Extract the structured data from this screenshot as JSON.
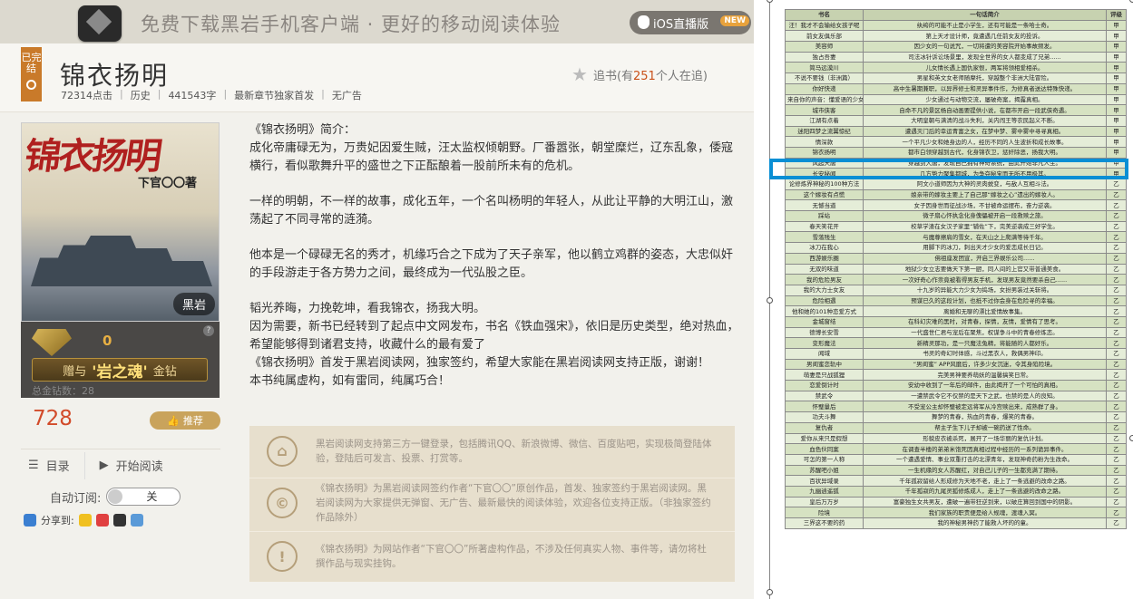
{
  "banner": {
    "text": "免费下载黑岩手机客户端 · 更好的移动阅读体验",
    "ios_label": "iOS直播版",
    "new_badge": "NEW"
  },
  "book": {
    "status": "已完结",
    "title": "锦衣扬明",
    "meta": [
      "72314点击",
      "|",
      "历史",
      "|",
      "441543字",
      "|",
      "最新章节独家首发",
      "|",
      "无广告"
    ],
    "follow_prefix": "追书(有",
    "follow_count": "251",
    "follow_suffix": "个人在追)",
    "cover_title": "锦衣扬明",
    "cover_author": "下官〇〇著",
    "cover_brand": "黑岩",
    "gift_count": "0",
    "gift_btn_pre": "赠与",
    "gift_btn_big": "'岩之魂'",
    "gift_btn_post": "金钻",
    "gift_total": "总金钻数：28",
    "votes": "728",
    "recommend": "推荐",
    "nav_catalog": "目录",
    "nav_read": "开始阅读",
    "auto_label": "自动订阅:",
    "auto_value": "关",
    "share_label": "分享到:"
  },
  "intro": {
    "p1": "《锦衣扬明》简介：",
    "p2": "成化帝庸碌无为，万贵妃因爱生贼，汪太监权倾朝野。厂番嚣张，朝堂糜烂，辽东乱象，倭寇横行，看似歌舞升平的盛世之下正酝酿着一股前所未有的危机。",
    "p3": "一样的明朝，不一样的故事，成化五年，一个名叫杨明的年轻人，从此让平静的大明江山，激荡起了不同寻常的涟漪。",
    "p4": "他本是一个碌碌无名的秀才，机缘巧合之下成为了天子亲军，他以鹤立鸡群的姿态，大忠似奸的手段游走于各方势力之间，最终成为一代弘股之臣。",
    "p5": "韬光养晦，力挽乾坤，看我锦衣，扬我大明。",
    "p6": "因为需要，新书已经转到了起点中文网发布，书名《铁血强宋》，依旧是历史类型，绝对热血，希望能够得到诸君支持，收藏什么的最有爱了",
    "p7": "《锦衣扬明》首发于黑岩阅读网，独家签约，希望大家能在黑岩阅读网支持正版，谢谢！",
    "p8": "本书纯属虚构，如有雷同，纯属巧合！"
  },
  "notes": [
    {
      "icon": "lock",
      "text": "黑岩阅读网支持第三方一键登录，包括腾讯QQ、新浪微博、微信、百度贴吧，实现极简登陆体验，登陆后可发言、投票、打赏等。"
    },
    {
      "icon": "copyright",
      "text": "《锦衣扬明》为黑岩阅读网签约作者“下官〇〇”原创作品，首发、独家签约于黑岩阅读网。黑岩阅读网为大家提供无弹窗、无广告、最新最快的阅读体验，欢迎各位支持正版。（非独家签约作品除外）"
    },
    {
      "icon": "warning",
      "text": "《锦衣扬明》为网站作者“下官〇〇”所著虚构作品，不涉及任何真实人物、事件等，请勿将杜撰作品与现实挂钩。"
    }
  ],
  "table": {
    "headers": [
      "书名",
      "一句话简介",
      "评级"
    ],
    "rows": [
      [
        "汪！我才不会输给女孩子呢",
        "纨绔的可能不止是小学生，还有可能是一条哈士奇。",
        "甲"
      ],
      [
        "前女友俱乐部",
        "第上天才设计师，竟遭遇几任前女友的投诉。",
        "甲"
      ],
      [
        "美容师",
        "因少女的一句说咒，一切将遭的美容院开始事故频发。",
        "甲"
      ],
      [
        "独占吾妻",
        "司法冰针诉讼场景里，发现全世界的女人都变成了兄弟......",
        "甲"
      ],
      [
        "简马远漠川",
        "儿女情长遇上国仇家恨，两军将领相爱相杀。",
        "甲"
      ],
      [
        "不说不要钱（非洲篇）",
        "男星和英文女老师随摩托，穿越整个非洲大陆冒险。",
        "甲"
      ],
      [
        "你好快递",
        "高中生暑期兼职，以异界修士和灵异事件作，为修真者送达特殊快递。",
        "甲"
      ],
      [
        "来自你的声音：懂爱语的少女",
        "少女通过与动物交流，屡破奇案，揭露真相。",
        "甲"
      ],
      [
        "城市侠客",
        "自命不凡的景区杨自动画要提供小说，在都市开启一段武侠奇遇。",
        "甲"
      ],
      [
        "江湖有点着",
        "大明皇朝与满清的战斗失利，关内闯王等农民起义不断。",
        "甲"
      ],
      [
        "迷阳四梦之流翼惊纪",
        "遭遇灭门后的幸运青富之女，在梦中梦、雾中雾中寻寻真相。",
        "甲"
      ],
      [
        "情深款",
        "一个平凡少女和她身边的人，经历不同的人生波折和成长故事。",
        "甲"
      ],
      [
        "锦衣扬明",
        "都市白领穿越到古代，化身锦衣卫，惩奸除恶，扬我大明。",
        "甲"
      ],
      [
        "风起天唐",
        "穿越到大唐，发现自己拥有神奇系统，由此开始非凡人生。",
        "甲"
      ],
      [
        "长安秘闻",
        "几方势力聚集都城，为争夺秘宝而无所不用极其。",
        "甲"
      ],
      [
        "论修炼界神秘的100种方法",
        "阿文小道师因为大神的灵肉蜕变，与敌人互相斗法。",
        "乙"
      ],
      [
        "这个嫁妆有点慌",
        "娘亲带的嫁妆主要上了自己那“嫁妆之心”遗出的嫁妆人。",
        "乙"
      ],
      [
        "无憾当道",
        "女子因身世而征战沙场，不甘被命运摆布，奋力逆袭。",
        "乙"
      ],
      [
        "踩站",
        "微子扇心怀执念化身傀儡被开启一段救赎之旅。",
        "乙"
      ],
      [
        "春天笑花开",
        "校草学渣在女汉子家里“辅佐”下，完美逆袭成三好学生。",
        "乙"
      ],
      [
        "雪落残生",
        "与魔尊擦肩的雪女，在天山之上爬满等待千年。",
        "乙"
      ],
      [
        "冰刀在我心",
        "用脚下的冰刀，刺出天才少女的爱恋成长日记。",
        "乙"
      ],
      [
        "西游娱乐圈",
        "佛祖座发团宣，开启三界娱乐公司......",
        "乙"
      ],
      [
        "无双的味道",
        "地狱少女立志要做天下第一厨，同人间的上官又带普通美食。",
        "乙"
      ],
      [
        "我的危险男友",
        "一次好奇心作祟竟被看得男友手机，发现男友竟然要杀自己......",
        "乙"
      ],
      [
        "我的大力士女友",
        "十九岁的异能大力少女为捣场，女扮男装过关斩将。",
        "乙"
      ],
      [
        "危险相遇",
        "预谋已久的这段计划，也抵不过你会身在危险寻的幸福。",
        "乙"
      ],
      [
        "他和她的101种恋爱方式",
        "离婚和无聊的漂比爱情故事集。",
        "乙"
      ],
      [
        "金城窗结",
        "在科幻灾难的黑时，对青春，探情，友情，爱情有了思考。",
        "乙"
      ],
      [
        "德博长安雪",
        "一代盛世仁君与宠后在聚焦，权谋争斗中的青春修炼恋。",
        "乙"
      ],
      [
        "变形魔法",
        "新精灵那功，是一只魔法兔精，将能随的人都好乐。",
        "乙"
      ],
      [
        "闻域",
        "书灵的奇幻时体感，斗过黑衣人，救偶男神印。",
        "乙"
      ],
      [
        "男闺蜜恋轨中",
        "“男闺蜜” APP风靡后，许多少女沉迷，令其身陷险境。",
        "乙"
      ],
      [
        "萌妻是只战狐狸",
        "完美男神要养萌妖的温馨搞笑日常。",
        "乙"
      ],
      [
        "恋爱倒计时",
        "安幼中收到了一年后的邮件，由此揭开了一个可怕的真相。",
        "乙"
      ],
      [
        "禁武令",
        "一遭禁武令它不仅禁的是天下之武，也禁的是人的良知。",
        "乙"
      ],
      [
        "怀璧量后",
        "不受宠公主却怀璧被定远将军从冷宫赎出来，成熟群了身。",
        "乙"
      ],
      [
        "功夫斗舞",
        "舞梦的青春，热血的青春，爆笑的青春。",
        "乙"
      ],
      [
        "复仇者",
        "帮主子生下儿子却被一碗药送了性命。",
        "乙"
      ],
      [
        "爱你从来只是假想",
        "形貌皮衣被杀死，展开了一场华丽的复仇计划。",
        "乙"
      ],
      [
        "血色伙同案",
        "在调查半楼的弟弟米饱死因真相过程中经历的一系列诡异事件。",
        "乙"
      ],
      [
        "可怎的第一人称",
        "一个遭遇爱情、事业双重打击的北漂青年，发现神奇药粉为生改命。",
        "乙"
      ],
      [
        "苏醒吧小姐",
        "一生机缘的女人苏醒红，对自己儿子的一生都充满了期待。",
        "乙"
      ],
      [
        "百状异域录",
        "千年孤寂留给人形成修为天地不老，走上了一条逃避的改命之路。",
        "乙"
      ],
      [
        "九幽逍遥狐",
        "千年孤寂的九尾灵狐修炼成人，走上了一条逃避的改命之路。",
        "乙"
      ],
      [
        "皇后万万岁",
        "富豪独生女共男友，遭破一遍带狂逆到来，以破庄算回到国中的阴影。",
        "乙"
      ],
      [
        "险境",
        "我们家族的职责便是给人规魂，渡魂入冥。",
        "乙"
      ],
      [
        "三界这不要的药",
        "我的神秘男神药了能救人坏的的童。",
        "乙"
      ]
    ]
  }
}
